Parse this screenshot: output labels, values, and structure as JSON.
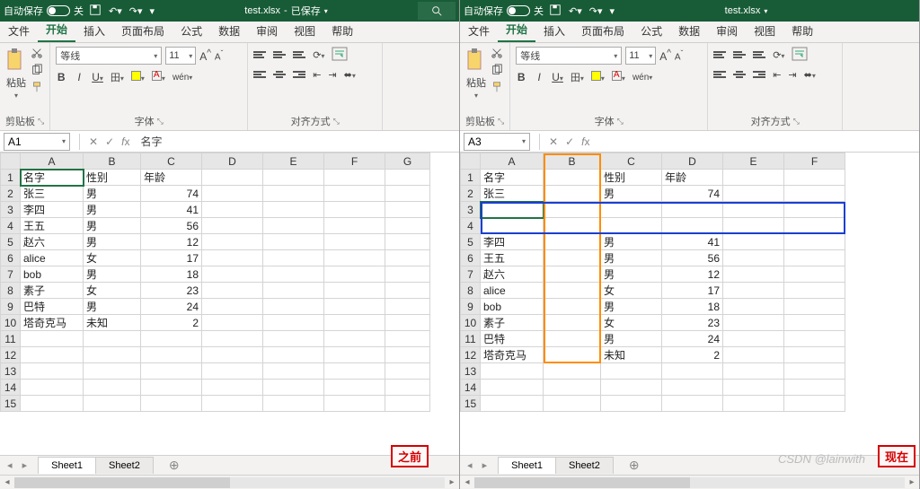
{
  "left": {
    "titlebar": {
      "autosave": "自动保存",
      "toggle_state": "关",
      "filename": "test.xlsx",
      "status": "已保存"
    },
    "tabs": [
      "文件",
      "开始",
      "插入",
      "页面布局",
      "公式",
      "数据",
      "审阅",
      "视图",
      "帮助"
    ],
    "active_tab": "开始",
    "ribbon": {
      "clipboard_label": "剪贴板",
      "paste_label": "粘贴",
      "font_label": "字体",
      "font_name": "等线",
      "font_size": "11",
      "align_label": "对齐方式",
      "wen_label": "wén"
    },
    "namebox": "A1",
    "formula_value": "名字",
    "columns": [
      "A",
      "B",
      "C",
      "D",
      "E",
      "F",
      "G"
    ],
    "rows": [
      {
        "n": 1,
        "A": "名字",
        "B": "性别",
        "C": "年龄"
      },
      {
        "n": 2,
        "A": "张三",
        "B": "男",
        "C": 74
      },
      {
        "n": 3,
        "A": "李四",
        "B": "男",
        "C": 41
      },
      {
        "n": 4,
        "A": "王五",
        "B": "男",
        "C": 56
      },
      {
        "n": 5,
        "A": "赵六",
        "B": "男",
        "C": 12
      },
      {
        "n": 6,
        "A": "alice",
        "B": "女",
        "C": 17
      },
      {
        "n": 7,
        "A": "bob",
        "B": "男",
        "C": 18
      },
      {
        "n": 8,
        "A": "素子",
        "B": "女",
        "C": 23
      },
      {
        "n": 9,
        "A": "巴特",
        "B": "男",
        "C": 24
      },
      {
        "n": 10,
        "A": "塔奇克马",
        "B": "未知",
        "C": 2
      },
      {
        "n": 11
      },
      {
        "n": 12
      },
      {
        "n": 13
      },
      {
        "n": 14
      },
      {
        "n": 15
      }
    ],
    "sheets": [
      "Sheet1",
      "Sheet2"
    ],
    "active_sheet": "Sheet1",
    "corner_label": "之前"
  },
  "right": {
    "titlebar": {
      "autosave": "自动保存",
      "toggle_state": "关",
      "filename": "test.xlsx",
      "status": ""
    },
    "tabs": [
      "文件",
      "开始",
      "插入",
      "页面布局",
      "公式",
      "数据",
      "审阅",
      "视图",
      "帮助"
    ],
    "active_tab": "开始",
    "ribbon": {
      "clipboard_label": "剪贴板",
      "paste_label": "粘贴",
      "font_label": "字体",
      "font_name": "等线",
      "font_size": "11",
      "align_label": "对齐方式",
      "wen_label": "wén"
    },
    "namebox": "A3",
    "formula_value": "",
    "columns": [
      "A",
      "B",
      "C",
      "D",
      "E",
      "F"
    ],
    "rows": [
      {
        "n": 1,
        "A": "名字",
        "C": "性别",
        "D": "年龄"
      },
      {
        "n": 2,
        "A": "张三",
        "C": "男",
        "D": 74
      },
      {
        "n": 3
      },
      {
        "n": 4
      },
      {
        "n": 5,
        "A": "李四",
        "C": "男",
        "D": 41
      },
      {
        "n": 6,
        "A": "王五",
        "C": "男",
        "D": 56
      },
      {
        "n": 7,
        "A": "赵六",
        "C": "男",
        "D": 12
      },
      {
        "n": 8,
        "A": "alice",
        "C": "女",
        "D": 17
      },
      {
        "n": 9,
        "A": "bob",
        "C": "男",
        "D": 18
      },
      {
        "n": 10,
        "A": "素子",
        "C": "女",
        "D": 23
      },
      {
        "n": 11,
        "A": "巴特",
        "C": "男",
        "D": 24
      },
      {
        "n": 12,
        "A": "塔奇克马",
        "C": "未知",
        "D": 2
      },
      {
        "n": 13
      },
      {
        "n": 14
      },
      {
        "n": 15
      }
    ],
    "sheets": [
      "Sheet1",
      "Sheet2"
    ],
    "active_sheet": "Sheet1",
    "corner_label": "现在",
    "watermark": "CSDN @lainwith"
  }
}
